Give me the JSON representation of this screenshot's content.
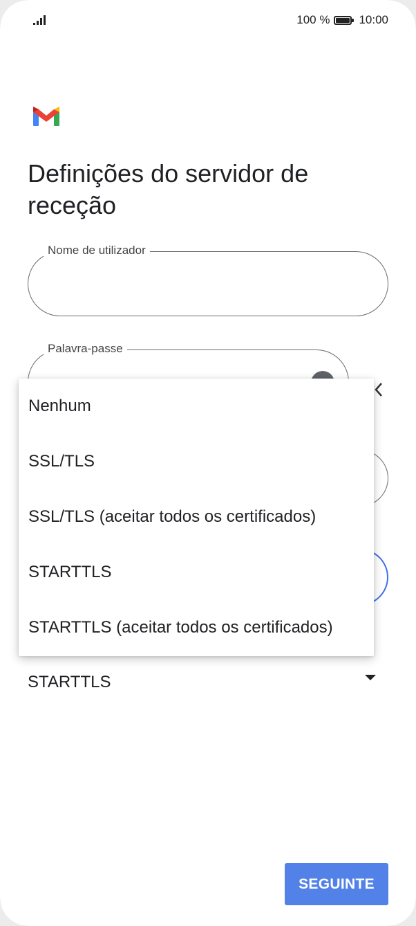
{
  "status_bar": {
    "battery_percent": "100 %",
    "time": "10:00"
  },
  "app": {
    "logo_icon": "gmail-logo-icon"
  },
  "page": {
    "title": "Definições do servidor de receção"
  },
  "form": {
    "username_label": "Nome de utilizador",
    "username_value": "",
    "password_label": "Palavra-passe",
    "password_value": "",
    "security_type_value": "STARTTLS"
  },
  "security_menu": {
    "options": [
      "Nenhum",
      "SSL/TLS",
      "SSL/TLS (aceitar todos os certificados)",
      "STARTTLS",
      "STARTTLS (aceitar todos os certificados)"
    ]
  },
  "actions": {
    "next_label": "SEGUINTE"
  },
  "colors": {
    "accent": "#5282e8",
    "focus_outline": "#3f73e6"
  }
}
